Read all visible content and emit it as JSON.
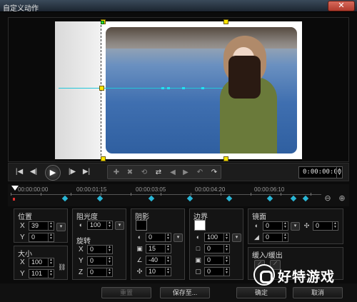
{
  "window": {
    "title": "自定义动作",
    "close_icon": "close-icon"
  },
  "preview": {
    "timecode": "0:00:00:00"
  },
  "timeline": {
    "ticks": [
      "00:00:00:00",
      "00:00:01:15",
      "00:00:03:05",
      "00:00:04:20",
      "00:00:06:10"
    ]
  },
  "position": {
    "label": "位置",
    "x_label": "X",
    "x": "39",
    "y_label": "Y",
    "y": "0"
  },
  "size": {
    "label": "大小",
    "x_label": "X",
    "x": "100",
    "y_label": "Y",
    "y": "101"
  },
  "opacity": {
    "label": "阻光度",
    "value": "100"
  },
  "rotation": {
    "label": "旋转",
    "x_label": "X",
    "x": "0",
    "y_label": "Y",
    "y": "0",
    "z_label": "Z",
    "z": "0"
  },
  "shadow": {
    "label": "阴影",
    "color": "#000000",
    "opacity": "0",
    "blur": "15",
    "angle": "-40",
    "distance": "10"
  },
  "border": {
    "label": "边界",
    "color": "#ffffff",
    "opacity": "100",
    "width": "0",
    "softness": "0",
    "round": "0"
  },
  "mirror": {
    "label": "镜面",
    "opacity": "0",
    "offset": "0",
    "distance": "0"
  },
  "easing": {
    "label": "缓入/缓出"
  },
  "buttons": {
    "reset": "重置",
    "save_as": "保存至...",
    "ok": "确定",
    "cancel": "取消"
  },
  "watermark": {
    "text": "好特游戏"
  }
}
